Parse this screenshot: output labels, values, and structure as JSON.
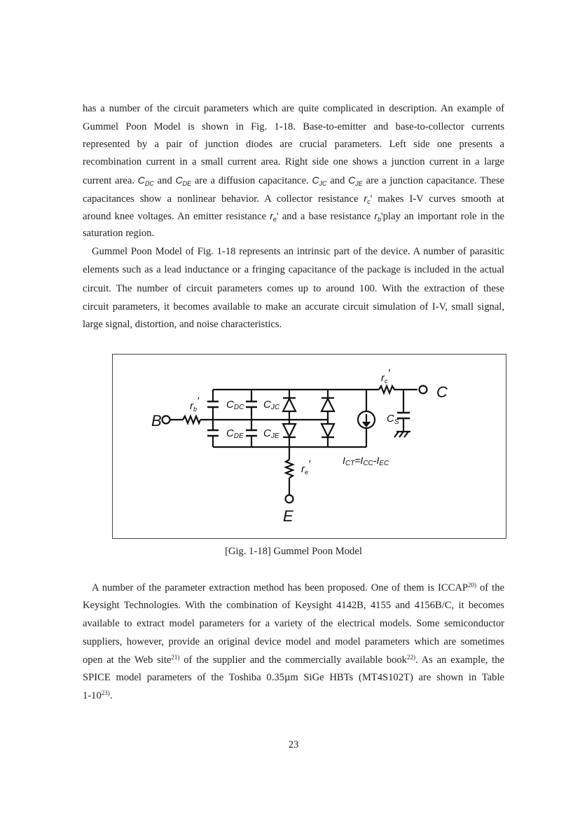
{
  "paragraphs": [
    {
      "lines": [
        [
          "has a number of the circuit parameters which are quite complicated in description. An example of"
        ],
        [
          "Gummel Poon Model is shown in Fig. 1-18. Base-to-emitter and base-to-collector currents"
        ],
        [
          "represented by a pair of junction diodes are crucial parameters. Left side one presents a"
        ],
        [
          "recombination current in a small current area. Right side one shows a junction current in a large"
        ],
        [
          "current area. ",
          {
            "v": "C",
            "sub": "DC"
          },
          " and ",
          {
            "v": "C",
            "sub": "DE"
          },
          " are a diffusion capacitance. ",
          {
            "v": "C",
            "sub": "JC"
          },
          " and ",
          {
            "v": "C",
            "sub": "JE"
          },
          " are a junction capacitance. These"
        ],
        [
          "capacitances show a nonlinear behavior. A collector resistance ",
          {
            "v": "r",
            "sub": "c"
          },
          "' makes I-V curves smooth at"
        ],
        [
          "around knee voltages. An emitter resistance ",
          {
            "v": "r",
            "sub": "e"
          },
          "' and a base resistance ",
          {
            "v": "r",
            "sub": "b"
          },
          "'play an important role in the"
        ],
        [
          "saturation region."
        ]
      ]
    },
    {
      "lines": [
        [
          "Gummel Poon Model of Fig. 1-18 represents an intrinsic part of the device. A number of parasitic"
        ],
        [
          "elements such as a lead inductance or a fringing capacitance of the package is included in the actual"
        ],
        [
          "circuit. The number of circuit parameters comes up to around 100. With the extraction of these"
        ],
        [
          "circuit parameters, it becomes available to make an accurate circuit simulation of I-V, small signal,"
        ],
        [
          "large signal, distortion, and noise characteristics."
        ]
      ]
    },
    {
      "lines": [
        [
          "A number of the parameter extraction method has been proposed. One of them is ICCAP",
          {
            "sup": "20)"
          },
          " of the"
        ],
        [
          "Keysight Technologies. With the combination of Keysight 4142B, 4155 and 4156B/C, it becomes"
        ],
        [
          "available to extract model parameters for a variety of the electrical models. Some semiconductor"
        ],
        [
          "suppliers, however, provide an original device model and model parameters which are sometimes"
        ],
        [
          "open at the Web site",
          {
            "sup": "21)"
          },
          " of the supplier and the commercially available book",
          {
            "sup": "22)"
          },
          ". As an example, the"
        ],
        [
          "SPICE model parameters of the Toshiba 0.35µm SiGe HBTs (MT4S102T) are shown in Table"
        ],
        [
          "1-10",
          {
            "sup": "23)"
          },
          "."
        ]
      ]
    }
  ],
  "figure": {
    "caption": "[Gig. 1-18]    Gummel Poon Model",
    "labels": {
      "base": "B",
      "collector": "C",
      "emitter": "E",
      "rb": "r",
      "rb_sub": "b",
      "rc": "r",
      "rc_sub": "c",
      "re": "r",
      "re_sub": "e",
      "prime": "'",
      "cdc": "C",
      "cdc_sub": "DC",
      "cde": "C",
      "cde_sub": "DE",
      "cjc": "C",
      "cjc_sub": "JC",
      "cje": "C",
      "cje_sub": "JE",
      "cs": "C",
      "cs_sub": "S",
      "ict": "I",
      "ict_sub": "CT",
      "eq": "=",
      "icc": "I",
      "icc_sub": "CC",
      "minus": "-",
      "iec": "I",
      "iec_sub": "EC"
    }
  },
  "page_number": "23"
}
